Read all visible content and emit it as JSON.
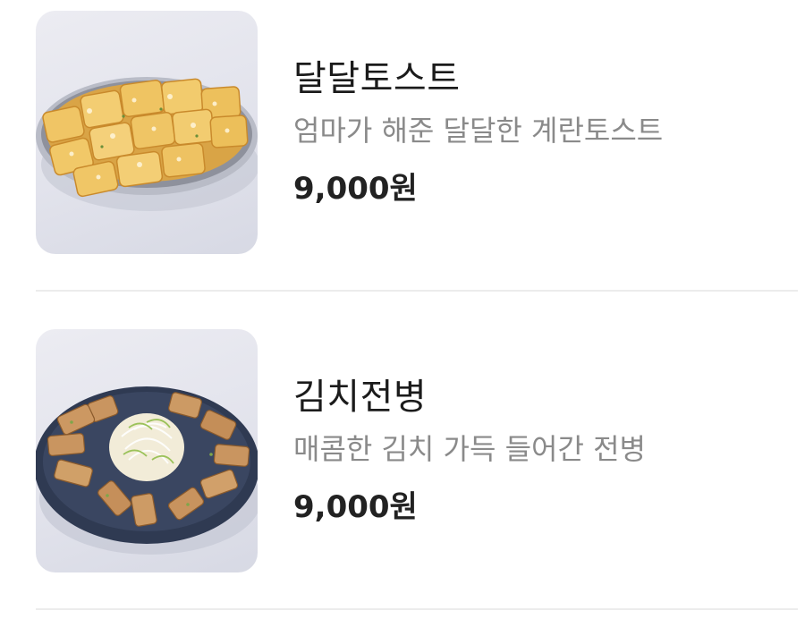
{
  "menu": {
    "items": [
      {
        "name": "달달토스트",
        "description": "엄마가 해준 달달한 계란토스트",
        "price": "9,000원"
      },
      {
        "name": "김치전병",
        "description": "매콤한 김치 가득 들어간 전병",
        "price": "9,000원"
      }
    ]
  },
  "colors": {
    "text_primary": "#1b1b1b",
    "text_secondary": "#8a8a8a",
    "divider": "#ececec",
    "thumb_background": "#e2e3ec"
  }
}
